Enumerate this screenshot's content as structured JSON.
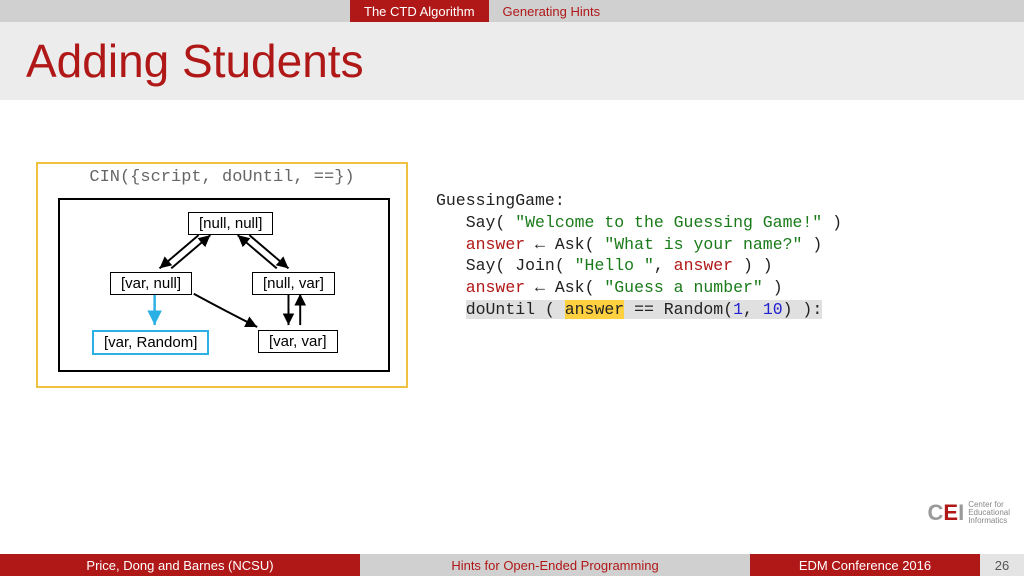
{
  "topbar": {
    "tab_active": "The CTD Algorithm",
    "tab_inactive": "Generating Hints"
  },
  "title": "Adding Students",
  "diagram": {
    "cin": "CIN({script, doUntil, ==})",
    "nodes": {
      "top": "[null, null]",
      "left_mid": "[var, null]",
      "right_mid": "[null, var]",
      "left_bot": "[var, Random]",
      "right_bot": "[var, var]"
    }
  },
  "code": {
    "name": "GuessingGame:",
    "say1_pre": "Say( ",
    "say1_str": "\"Welcome to the Guessing Game!\"",
    "say1_post": " )",
    "ans_kw": "answer",
    "arrow": " ← ",
    "ask": "Ask( ",
    "ask1_str": "\"What is your name?\"",
    "close": " )",
    "say2_pre": "Say( Join( ",
    "say2_str": "\"Hello \"",
    "say2_mid": ", ",
    "say2_post": " ) )",
    "ask2_str": "\"Guess a number\"",
    "do_pre": "doUntil ( ",
    "do_ans": "answer",
    "do_mid": " == Random(",
    "do_n1": "1",
    "do_comma": ", ",
    "do_n2": "10",
    "do_post": ") ):"
  },
  "footer": {
    "authors": "Price, Dong and Barnes (NCSU)",
    "middle": "Hints for Open-Ended Programming",
    "conference": "EDM Conference 2016",
    "page": "26"
  },
  "logo": {
    "c": "C",
    "e": "E",
    "i": "I",
    "line1": "Center for",
    "line2": "Educational",
    "line3": "Informatics"
  }
}
